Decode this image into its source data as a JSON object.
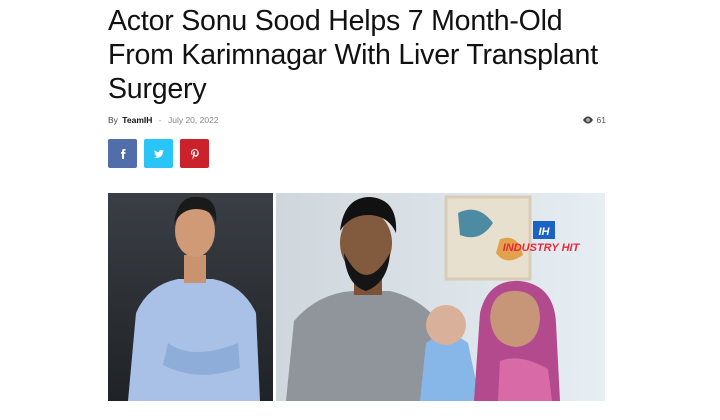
{
  "article": {
    "title": "Actor Sonu Sood Helps 7 Month-Old From Karimnagar With Liver Transplant Surgery",
    "by_label": "By",
    "author": "TeamIH",
    "separator": "-",
    "date": "July 20, 2022",
    "views": "61",
    "share_icons": [
      "facebook-icon",
      "twitter-icon",
      "pinterest-icon"
    ],
    "share_colors": {
      "facebook": "#516eab",
      "twitter": "#29c5f6",
      "pinterest": "#ca212a"
    },
    "featured_image": {
      "watermark_logo": "IH",
      "watermark_text": "INDUSTRY HIT"
    }
  }
}
